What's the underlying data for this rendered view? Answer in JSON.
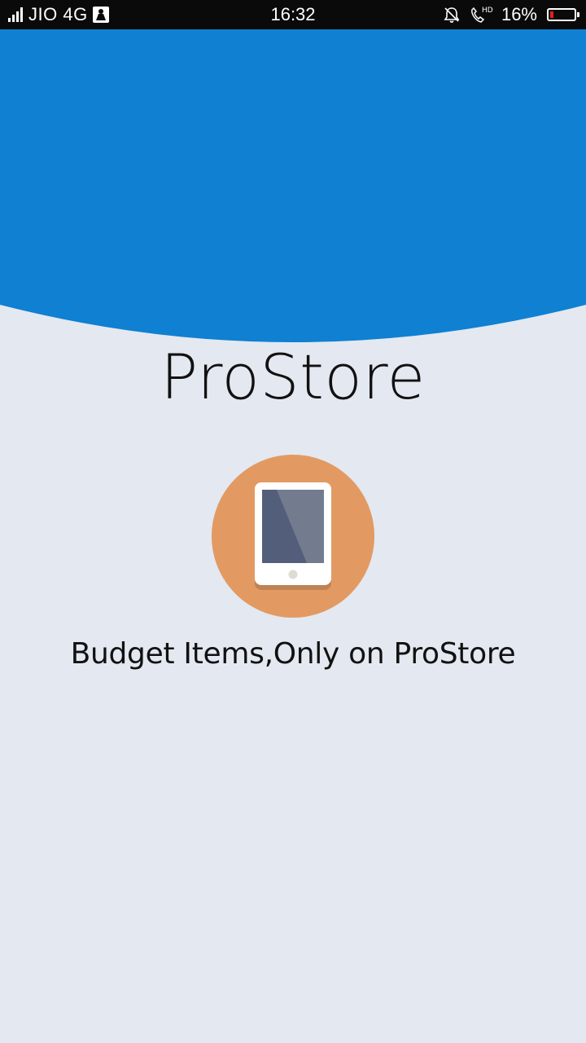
{
  "status_bar": {
    "carrier": "JIO 4G",
    "time": "16:32",
    "battery_percent": "16%",
    "battery_level": 0.16,
    "icons": [
      "signal-icon",
      "notification-badge-icon",
      "mute-bell-icon",
      "hd-call-icon",
      "battery-icon"
    ]
  },
  "header": {
    "color": "#0f80d2"
  },
  "app": {
    "title": "ProStore",
    "tagline": "Budget Items,Only on ProStore",
    "logo": {
      "icon": "tablet-icon",
      "circle_color": "#e29a62",
      "device_frame_color": "#ffffff",
      "screen_color": "#535f7a",
      "screen_highlight_color": "#737c8e"
    }
  }
}
